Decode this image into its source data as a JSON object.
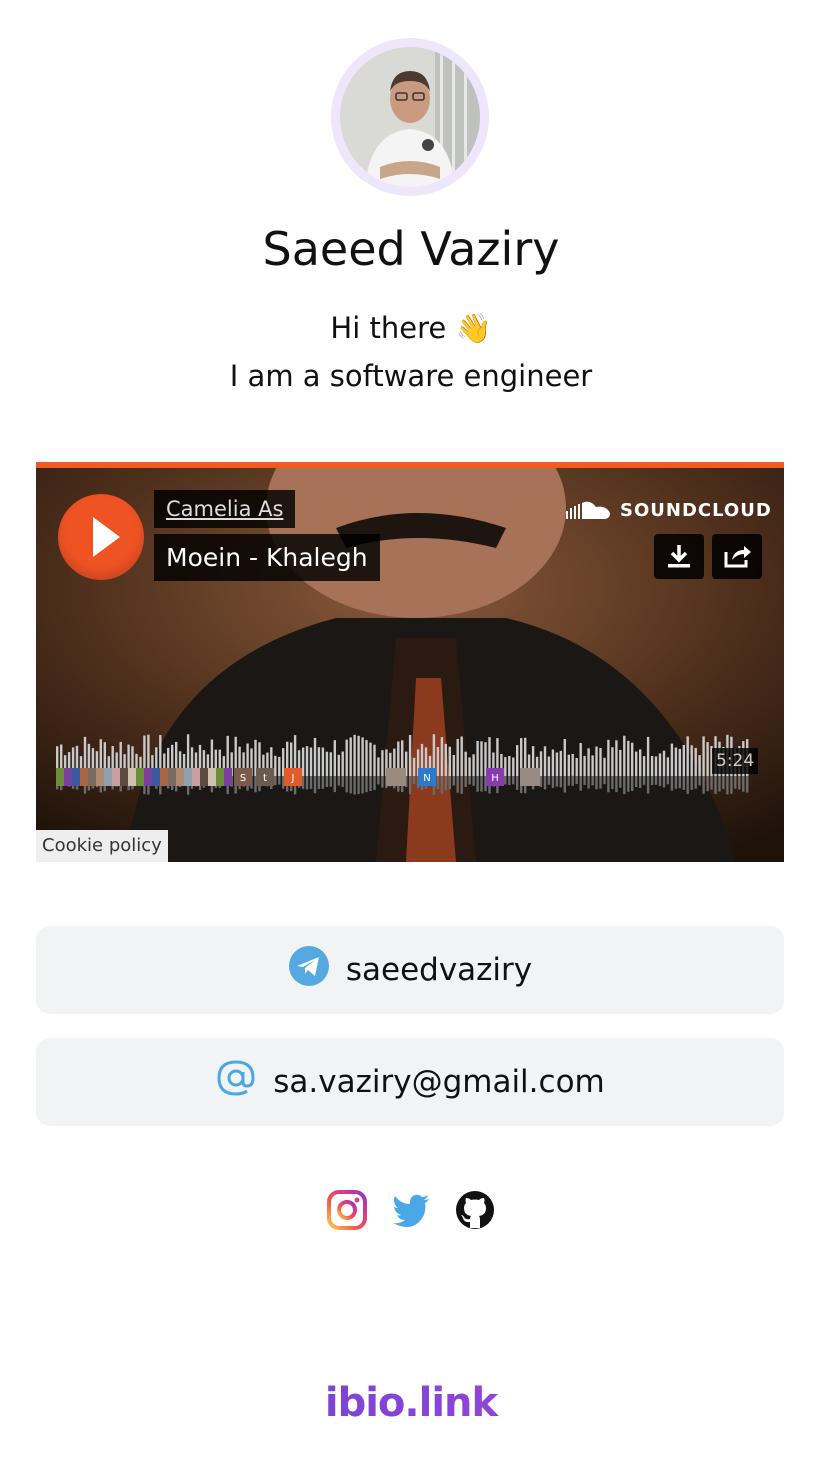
{
  "profile": {
    "name": "Saeed Vaziry",
    "bio_line1": "Hi there 👋",
    "bio_line2": "I am a software engineer",
    "avatar_icon": "profile-photo"
  },
  "soundcloud": {
    "user": "Camelia As",
    "track": "Moein - Khalegh",
    "brand": "SOUNDCLOUD",
    "duration": "5:24",
    "cookie_policy": "Cookie policy",
    "accent_color": "#f35a1d",
    "comment_markers": [
      "S",
      "t",
      "J",
      "N",
      "H"
    ]
  },
  "links": [
    {
      "icon": "telegram-icon",
      "label": "saeedvaziry",
      "icon_color": "#54a9e0"
    },
    {
      "icon": "at-sign-icon",
      "label": "sa.vaziry@gmail.com",
      "icon_color": "#4aa8e6"
    }
  ],
  "socials": [
    "instagram-icon",
    "twitter-icon",
    "github-icon"
  ],
  "footer": {
    "brand": "ibio.link"
  }
}
